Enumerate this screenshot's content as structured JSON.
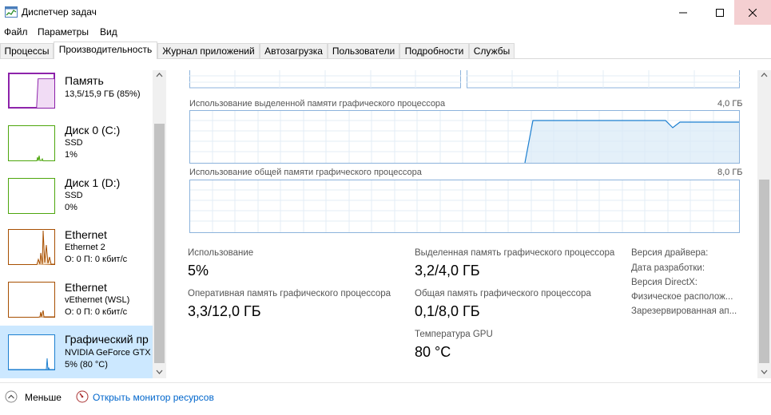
{
  "window": {
    "title": "Диспетчер задач"
  },
  "menu": {
    "items": [
      "Файл",
      "Параметры",
      "Вид"
    ]
  },
  "tabs": [
    "Процессы",
    "Производительность",
    "Журнал приложений",
    "Автозагрузка",
    "Пользователи",
    "Подробности",
    "Службы"
  ],
  "sidebar": {
    "devices": [
      {
        "title": "Память",
        "line1": "13,5/15,9 ГБ (85%)",
        "line2": "",
        "color": "#8b1fa9"
      },
      {
        "title": "Диск 0 (C:)",
        "line1": "SSD",
        "line2": "1%",
        "color": "#4da60c"
      },
      {
        "title": "Диск 1 (D:)",
        "line1": "SSD",
        "line2": "0%",
        "color": "#4da60c"
      },
      {
        "title": "Ethernet",
        "line1": "Ethernet 2",
        "line2": "О: 0 П: 0 кбит/с",
        "color": "#a74f01"
      },
      {
        "title": "Ethernet",
        "line1": "vEthernet (WSL)",
        "line2": "О: 0 П: 0 кбит/с",
        "color": "#a74f01"
      },
      {
        "title": "Графический пр",
        "line1": "NVIDIA GeForce GTX",
        "line2": "5% (80 °C)",
        "color": "#1c7fd0"
      }
    ]
  },
  "graphs": {
    "dedicated": {
      "label": "Использование выделенной памяти графического процессора",
      "max": "4,0 ГБ"
    },
    "shared": {
      "label": "Использование общей памяти графического процессора",
      "max": "8,0 ГБ"
    }
  },
  "stats": {
    "usage": {
      "label": "Использование",
      "value": "5%"
    },
    "gpu_ram": {
      "label": "Оперативная память графического процессора",
      "value": "3,3/12,0 ГБ"
    },
    "dedicated": {
      "label": "Выделенная память графического процессора",
      "value": "3,2/4,0 ГБ"
    },
    "shared": {
      "label": "Общая память графического процессора",
      "value": "0,1/8,0 ГБ"
    },
    "temp": {
      "label": "Температура GPU",
      "value": "80 °C"
    }
  },
  "info": [
    "Версия драйвера:",
    "Дата разработки:",
    "Версия DirectX:",
    "Физическое располож...",
    "Зарезервированная ап..."
  ],
  "footer": {
    "fewer": "Меньше",
    "monitor": "Открыть монитор ресурсов"
  },
  "colors": {
    "gpu": "#1c7fd0",
    "gpu_border": "#8cb3dc",
    "selected": "#cce8ff",
    "close_hover": "#f4cfd1",
    "link": "#0066cc"
  }
}
